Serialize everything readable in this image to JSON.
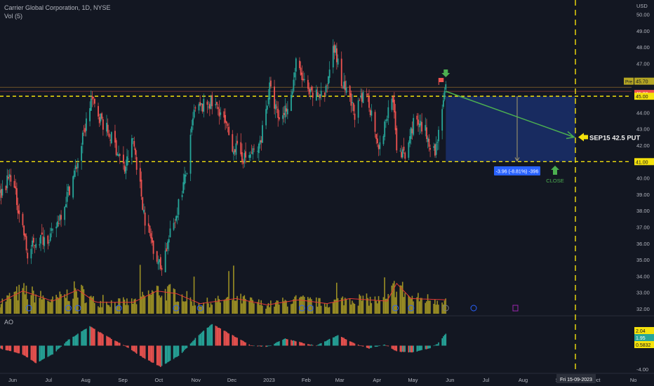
{
  "header": {
    "symbol_line": "Carrier Global Corporation, 1D, NYSE",
    "volume_label": "Vol (5)",
    "ao_label": "AO"
  },
  "colors": {
    "bg": "#131722",
    "up": "#26a69a",
    "down": "#ef5350",
    "volume": "#b5a624",
    "volume_ma": "#e53935",
    "level_line": "#f5e20c",
    "zone_fill": "#1a2f6b",
    "arrow": "#4caf50",
    "date_line": "#f5e20c",
    "badge_blue": "#2962ff"
  },
  "price_axis": {
    "currency": "USD",
    "ticks": [
      "50.00",
      "49.00",
      "48.00",
      "47.00",
      "46.00",
      "44.00",
      "43.00",
      "42.00",
      "40.00",
      "39.00",
      "38.00",
      "37.00",
      "36.00",
      "35.00",
      "34.00",
      "33.00",
      "32.00"
    ],
    "badges": [
      {
        "text": "Pre",
        "value": "45.70",
        "color": "#b5a624"
      },
      {
        "text": "",
        "value": "45.30",
        "color": "#ef5350"
      },
      {
        "text": "",
        "value": "45.00",
        "color": "#f5e20c"
      },
      {
        "text": "",
        "value": "41.00",
        "color": "#f5e20c"
      }
    ]
  },
  "ao_axis": {
    "badges": [
      {
        "value": "2.04",
        "color": "#f5e20c"
      },
      {
        "value": "1.95",
        "color": "#26a69a"
      },
      {
        "value": "0.5832",
        "color": "#f5e20c"
      }
    ],
    "ticks": [
      "-4.00"
    ]
  },
  "time_axis": {
    "labels": [
      "Jun",
      "Jul",
      "Aug",
      "Sep",
      "Oct",
      "Nov",
      "Dec",
      "2023",
      "Feb",
      "Mar",
      "Apr",
      "May",
      "Jun",
      "Jul",
      "Aug",
      "Sep",
      "Oct",
      "No"
    ],
    "date_badge": "Fri 15-09-2023"
  },
  "annotations": {
    "put_label": "SEP15 42.5 PUT",
    "close_label": "CLOSE",
    "measure_label": "-3.96 (-8.81%) -396"
  },
  "chart_data": {
    "type": "candlestick",
    "title": "Carrier Global Corporation, 1D, NYSE",
    "ylabel": "USD",
    "ylim": [
      31.7,
      50.8
    ],
    "x_start": "2022-06-01",
    "x_end": "2023-11-10",
    "key_levels": [
      45.0,
      41.0
    ],
    "projection": {
      "from": [
        "2023-06-08",
        45.3
      ],
      "to": [
        "2023-09-15",
        42.5
      ]
    },
    "price_path": [
      [
        "2022-06-01",
        39.0
      ],
      [
        "2022-06-10",
        40.2
      ],
      [
        "2022-06-20",
        37.0
      ],
      [
        "2022-06-24",
        35.2
      ],
      [
        "2022-07-01",
        36.2
      ],
      [
        "2022-07-15",
        36.5
      ],
      [
        "2022-07-25",
        38.5
      ],
      [
        "2022-08-05",
        41.0
      ],
      [
        "2022-08-16",
        44.8
      ],
      [
        "2022-08-25",
        43.5
      ],
      [
        "2022-09-05",
        42.0
      ],
      [
        "2022-09-13",
        40.5
      ],
      [
        "2022-09-20",
        42.4
      ],
      [
        "2022-09-30",
        37.5
      ],
      [
        "2022-10-07",
        35.8
      ],
      [
        "2022-10-13",
        34.5
      ],
      [
        "2022-10-25",
        37.5
      ],
      [
        "2022-11-04",
        40.5
      ],
      [
        "2022-11-10",
        44.0
      ],
      [
        "2022-11-22",
        44.6
      ],
      [
        "2022-12-01",
        44.2
      ],
      [
        "2022-12-12",
        42.0
      ],
      [
        "2022-12-22",
        41.2
      ],
      [
        "2023-01-03",
        41.8
      ],
      [
        "2023-01-12",
        45.5
      ],
      [
        "2023-01-20",
        43.5
      ],
      [
        "2023-01-30",
        45.0
      ],
      [
        "2023-02-03",
        47.0
      ],
      [
        "2023-02-14",
        45.0
      ],
      [
        "2023-02-28",
        45.2
      ],
      [
        "2023-03-06",
        48.5
      ],
      [
        "2023-03-13",
        45.8
      ],
      [
        "2023-03-24",
        44.0
      ],
      [
        "2023-04-03",
        45.2
      ],
      [
        "2023-04-14",
        41.8
      ],
      [
        "2023-04-24",
        45.2
      ],
      [
        "2023-04-28",
        42.0
      ],
      [
        "2023-05-05",
        41.2
      ],
      [
        "2023-05-12",
        43.5
      ],
      [
        "2023-05-22",
        42.8
      ],
      [
        "2023-05-30",
        41.5
      ],
      [
        "2023-06-01",
        42.5
      ],
      [
        "2023-06-05",
        44.5
      ],
      [
        "2023-06-08",
        45.3
      ]
    ],
    "volume_ma_path": [
      [
        "2022-06-01",
        0.45
      ],
      [
        "2022-06-20",
        0.9
      ],
      [
        "2022-07-15",
        0.5
      ],
      [
        "2022-08-05",
        0.95
      ],
      [
        "2022-08-20",
        0.45
      ],
      [
        "2022-09-20",
        0.45
      ],
      [
        "2022-10-10",
        0.9
      ],
      [
        "2022-10-26",
        0.8
      ],
      [
        "2022-11-15",
        0.4
      ],
      [
        "2022-12-15",
        0.6
      ],
      [
        "2023-01-10",
        0.35
      ],
      [
        "2023-02-05",
        0.55
      ],
      [
        "2023-03-01",
        0.4
      ],
      [
        "2023-03-20",
        0.6
      ],
      [
        "2023-04-20",
        0.5
      ],
      [
        "2023-04-28",
        1.2
      ],
      [
        "2023-05-10",
        0.6
      ],
      [
        "2023-06-08",
        0.55
      ]
    ],
    "ao_path": [
      [
        "2022-06-01",
        -0.5
      ],
      [
        "2022-06-20",
        -1.5
      ],
      [
        "2022-07-01",
        -3.0
      ],
      [
        "2022-07-15",
        -1.5
      ],
      [
        "2022-07-28",
        1.0
      ],
      [
        "2022-08-15",
        3.3
      ],
      [
        "2022-08-30",
        1.5
      ],
      [
        "2022-09-13",
        0.0
      ],
      [
        "2022-09-28",
        -2.0
      ],
      [
        "2022-10-13",
        -3.6
      ],
      [
        "2022-10-30",
        -1.5
      ],
      [
        "2022-11-12",
        1.5
      ],
      [
        "2022-11-25",
        3.7
      ],
      [
        "2022-12-10",
        2.0
      ],
      [
        "2022-12-28",
        0.0
      ],
      [
        "2023-01-10",
        -0.2
      ],
      [
        "2023-01-25",
        1.2
      ],
      [
        "2023-02-08",
        0.5
      ],
      [
        "2023-02-20",
        0.0
      ],
      [
        "2023-03-10",
        1.8
      ],
      [
        "2023-03-25",
        0.3
      ],
      [
        "2023-04-05",
        -0.5
      ],
      [
        "2023-04-18",
        0.2
      ],
      [
        "2023-04-28",
        -1.0
      ],
      [
        "2023-05-10",
        -1.2
      ],
      [
        "2023-05-25",
        -0.5
      ],
      [
        "2023-06-01",
        0.3
      ],
      [
        "2023-06-08",
        2.04
      ]
    ],
    "ao_ylim": [
      -4.5,
      4.5
    ]
  }
}
